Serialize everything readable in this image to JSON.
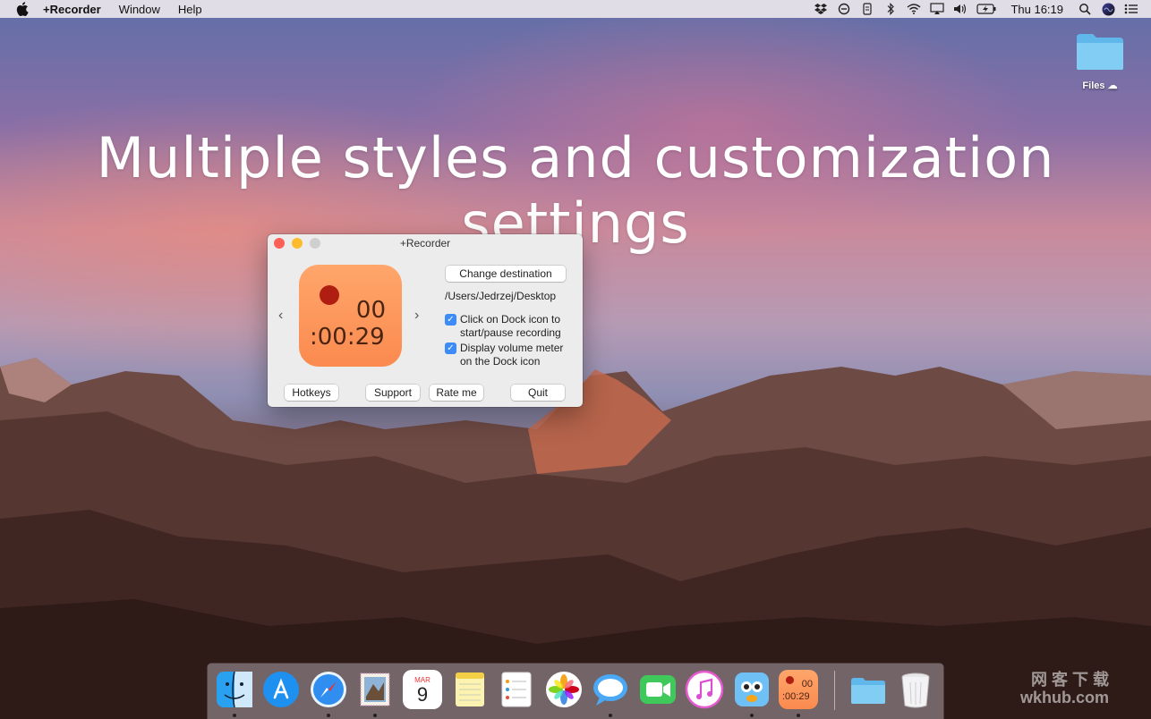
{
  "menubar": {
    "app_name": "+Recorder",
    "items": [
      "Window",
      "Help"
    ],
    "clock": "Thu 16:19",
    "status_icons": [
      "dropbox-icon",
      "timer-icon",
      "touch-icon",
      "bluetooth-icon",
      "wifi-icon",
      "airplay-icon",
      "volume-icon",
      "battery-icon",
      "search-icon",
      "siri-icon",
      "list-icon"
    ]
  },
  "desktop": {
    "folder_label": "Files",
    "headline": "Multiple styles and customization settings"
  },
  "window": {
    "title": "+Recorder",
    "recorder": {
      "top_digits": "00",
      "time": ":00:29"
    },
    "change_destination_label": "Change destination",
    "path": "/Users/Jedrzej/Desktop",
    "options": [
      {
        "line1": "Click on Dock icon to",
        "line2": "start/pause recording",
        "checked": true
      },
      {
        "line1": "Display volume meter",
        "line2": "on the Dock icon",
        "checked": true
      }
    ],
    "buttons": {
      "hotkeys": "Hotkeys",
      "support": "Support",
      "rate": "Rate me",
      "quit": "Quit"
    }
  },
  "dock": {
    "apps": [
      "finder-icon",
      "app-store-icon",
      "safari-icon",
      "mail-icon",
      "calendar-icon",
      "notes-icon",
      "reminders-icon",
      "photos-icon",
      "messages-icon",
      "facetime-icon",
      "itunes-icon",
      "tweetbot-icon",
      "recorder-icon",
      "folder-icon",
      "trash-icon"
    ],
    "calendar_month": "MAR",
    "calendar_day": "9",
    "recorder_top": "00",
    "recorder_time": ":00:29"
  },
  "watermark": {
    "line1": "网 客 下 载",
    "line2": "wkhub.com"
  },
  "colors": {
    "accent": "#3d8cf5",
    "recorder_tile": "#fb8a4f",
    "record_dot": "#b01e12"
  }
}
